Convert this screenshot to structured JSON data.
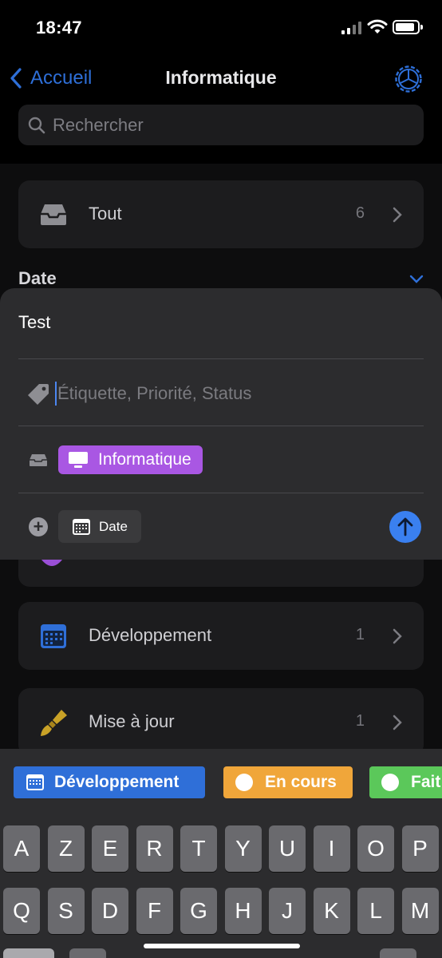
{
  "status": {
    "time": "18:47"
  },
  "nav": {
    "back_label": "Accueil",
    "title": "Informatique"
  },
  "search": {
    "placeholder": "Rechercher"
  },
  "list": {
    "all": {
      "label": "Tout",
      "count": "6"
    },
    "section_title": "Date",
    "items": [
      {
        "label": "Développement",
        "count": "1",
        "icon": "calendar-icon",
        "color": "#2f6fd8"
      },
      {
        "label": "Mise à jour",
        "count": "1",
        "icon": "paintbrush-icon",
        "color": "#c9a227"
      }
    ]
  },
  "sheet": {
    "title": "Test",
    "tags_placeholder": "Étiquette, Priorité, Status",
    "project": {
      "label": "Informatique",
      "color": "#a957e3"
    },
    "date_label": "Date"
  },
  "suggestions": [
    {
      "label": "Développement",
      "color": "#2f6fd8",
      "icon": "calendar-icon"
    },
    {
      "label": "En cours",
      "color": "#f0a63a",
      "icon": "circle-icon"
    },
    {
      "label": "Fait",
      "color": "#5bc85a",
      "icon": "circle-icon"
    }
  ],
  "keyboard": {
    "row1": [
      "A",
      "Z",
      "E",
      "R",
      "T",
      "Y",
      "U",
      "I",
      "O",
      "P"
    ],
    "row2": [
      "Q",
      "S",
      "D",
      "F",
      "G",
      "H",
      "J",
      "K",
      "L",
      "M"
    ]
  },
  "colors": {
    "accent": "#2e6fd8",
    "background": "#000000",
    "card": "#1c1c1e",
    "sheet": "#2c2c2e"
  }
}
